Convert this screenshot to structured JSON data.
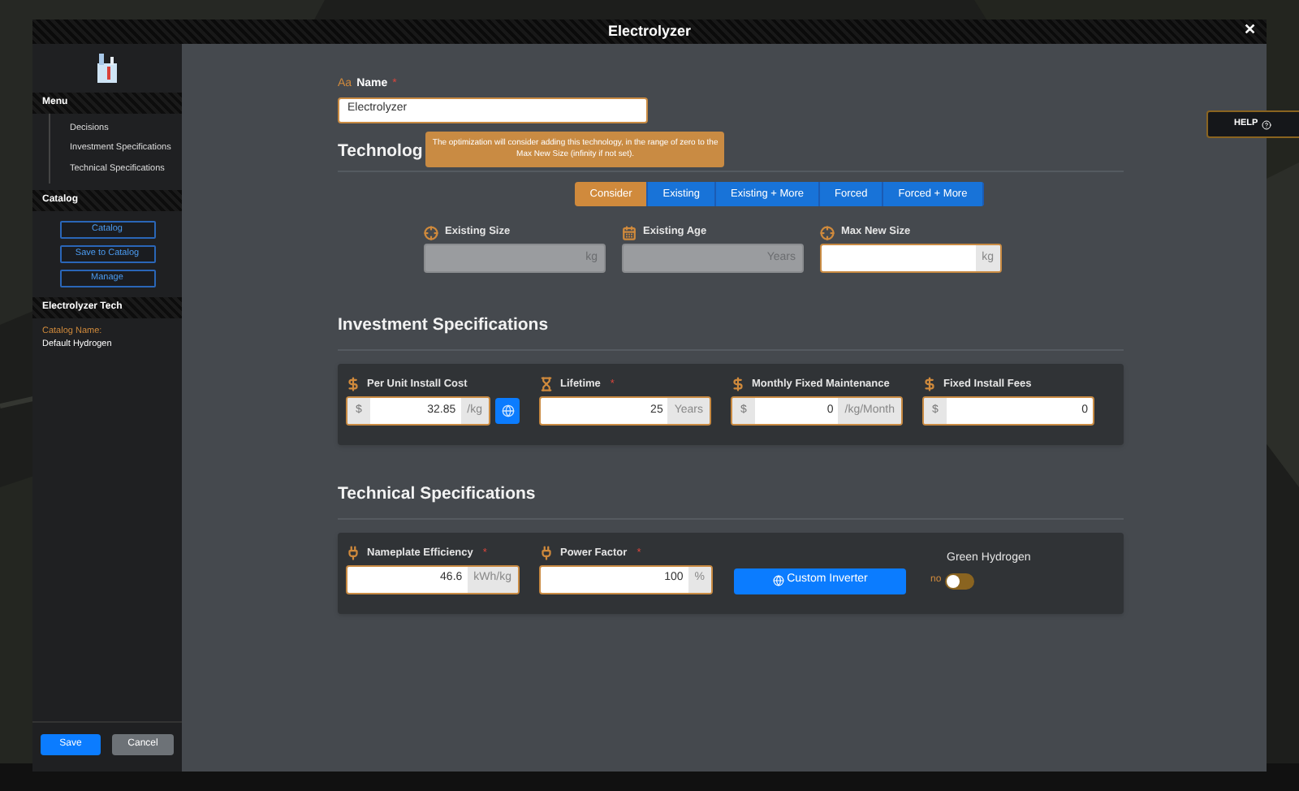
{
  "window": {
    "title": "Electrolyzer",
    "close": "✕"
  },
  "help": {
    "label": "HELP"
  },
  "sidebar": {
    "menu_title": "Menu",
    "menu_items": [
      "Decisions",
      "Investment Specifications",
      "Technical Specifications"
    ],
    "catalog_title": "Catalog",
    "catalog_buttons": [
      "Catalog",
      "Save to Catalog",
      "Manage"
    ],
    "tech_title": "Electrolyzer Tech",
    "catalog_name_label": "Catalog Name:",
    "catalog_name": "Default Hydrogen",
    "save": "Save",
    "cancel": "Cancel"
  },
  "name_field": {
    "icon_text": "Aa",
    "label": "Name",
    "required_mark": "*",
    "value": "Electrolyzer"
  },
  "technology": {
    "title": "Technolog",
    "tooltip": "The optimization will consider adding this technology, in the range of zero to the Max New Size (infinity if not set).",
    "modes": [
      {
        "label": "Consider",
        "selected": true
      },
      {
        "label": "Existing",
        "selected": false
      },
      {
        "label": "Existing + More",
        "selected": false
      },
      {
        "label": "Forced",
        "selected": false
      },
      {
        "label": "Forced + More",
        "selected": false
      }
    ],
    "fields": [
      {
        "label": "Existing Size",
        "suffix": "kg",
        "disabled": true
      },
      {
        "label": "Existing Age",
        "suffix": "Years",
        "disabled": true
      },
      {
        "label": "Max New Size",
        "suffix": "kg",
        "disabled": false
      }
    ]
  },
  "investment": {
    "title": "Investment Specifications",
    "fields": [
      {
        "label": "Per Unit Install Cost",
        "prefix": "$",
        "value": "32.85",
        "suffix": "/kg",
        "extra_button": true
      },
      {
        "label": "Lifetime",
        "required_mark": "*",
        "value": "25",
        "suffix": "Years",
        "extra_button": false
      },
      {
        "label": "Monthly Fixed Maintenance",
        "prefix": "$",
        "value": "0",
        "suffix": "/kg/Month",
        "extra_button": false
      },
      {
        "label": "Fixed Install Fees",
        "prefix": "$",
        "value": "0",
        "extra_button": false
      }
    ]
  },
  "technical": {
    "title": "Technical Specifications",
    "fields": [
      {
        "label": "Nameplate Efficiency",
        "required_mark": "*",
        "value": "46.6",
        "suffix": "kWh/kg"
      },
      {
        "label": "Power Factor",
        "required_mark": "*",
        "value": "100",
        "suffix": "%"
      }
    ],
    "custom_button": "Custom Inverter",
    "toggle": {
      "label": "Green Hydrogen",
      "state_text": "no",
      "on": false
    }
  }
}
